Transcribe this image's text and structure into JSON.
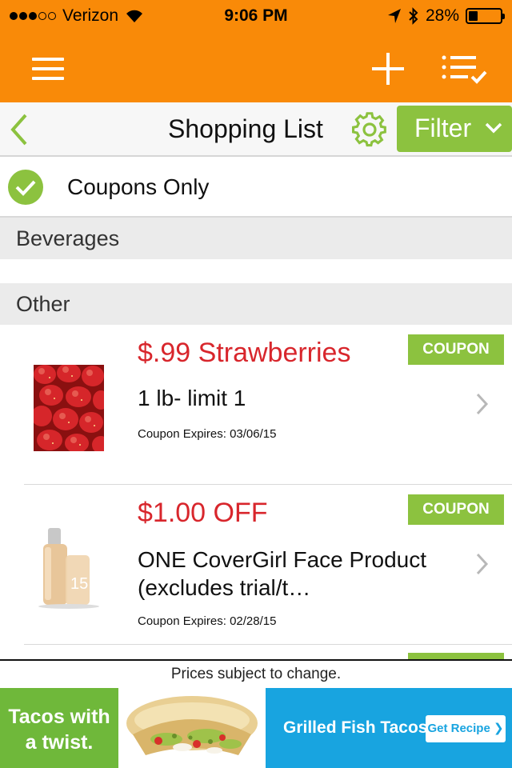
{
  "status_bar": {
    "carrier": "Verizon",
    "signal_bars_filled": 3,
    "signal_bars_total": 5,
    "time": "9:06 PM",
    "battery_percent": "28%",
    "battery_level": 0.28
  },
  "app_header": {
    "icons": [
      "hamburger-menu-icon",
      "plus-icon",
      "checklist-icon"
    ]
  },
  "nav": {
    "title": "Shopping List",
    "filter_label": "Filter"
  },
  "coupons_only": {
    "label": "Coupons Only",
    "checked": true
  },
  "sections": [
    {
      "label": "Beverages"
    },
    {
      "label": "Other"
    }
  ],
  "items": [
    {
      "price": "$.99 Strawberries",
      "description": "1 lb- limit 1",
      "expires": "Coupon Expires: 03/06/15",
      "badge": "COUPON",
      "image": "strawberries"
    },
    {
      "price": "$1.00 OFF",
      "description": "ONE CoverGirl Face Product (excludes trial/t…",
      "expires": "Coupon Expires: 02/28/15",
      "badge": "COUPON",
      "image": "foundation-bottle"
    }
  ],
  "footer": {
    "price_note": "Prices subject to change."
  },
  "ad": {
    "left_text": "Tacos with a twist.",
    "title": "Grilled Fish Tacos",
    "cta": "Get Recipe ❯"
  },
  "colors": {
    "header_orange": "#f98a08",
    "accent_green": "#8cc23f",
    "price_red": "#d8262c",
    "ad_blue": "#18a4e0"
  }
}
